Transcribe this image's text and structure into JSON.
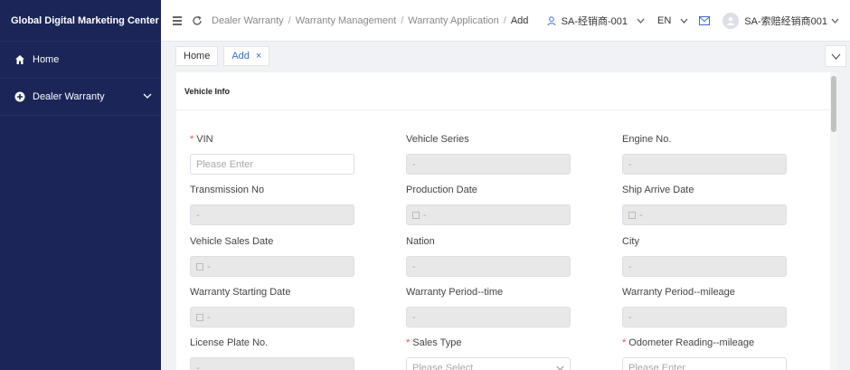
{
  "sidebar": {
    "brand": "Global Digital Marketing Center",
    "items": [
      {
        "label": "Home"
      },
      {
        "label": "Dealer Warranty"
      }
    ]
  },
  "topbar": {
    "breadcrumb": [
      "Dealer Warranty",
      "Warranty Management",
      "Warranty Application",
      "Add"
    ],
    "breadcrumb_sep": "/",
    "dealer": "SA-经销商-001",
    "lang": "EN",
    "user": "SA-索赔经销商001"
  },
  "tabs": [
    {
      "label": "Home"
    },
    {
      "label": "Add",
      "close": "×"
    }
  ],
  "form": {
    "section_title": "Vehicle Info",
    "placeholder_enter": "Please Enter",
    "placeholder_select": "Please Select",
    "empty": "-",
    "fields": {
      "vin": {
        "label": "VIN",
        "req": "*"
      },
      "series": {
        "label": "Vehicle Series"
      },
      "engine": {
        "label": "Engine No."
      },
      "transmission": {
        "label": "Transmission No"
      },
      "production": {
        "label": "Production Date"
      },
      "ship": {
        "label": "Ship Arrive Date"
      },
      "sales_date": {
        "label": "Vehicle Sales Date"
      },
      "nation": {
        "label": "Nation"
      },
      "city": {
        "label": "City"
      },
      "warranty_start": {
        "label": "Warranty Starting Date"
      },
      "period_time": {
        "label": "Warranty Period--time"
      },
      "period_mileage": {
        "label": "Warranty Period--mileage"
      },
      "license": {
        "label": "License Plate No."
      },
      "sales_type": {
        "label": "Sales Type",
        "req": "*"
      },
      "odometer": {
        "label": "Odometer Reading--mileage",
        "req": "*"
      }
    }
  },
  "colors": {
    "sidebar": "#1b2557",
    "accent": "#3a6bd6",
    "required": "#e64b4b"
  }
}
